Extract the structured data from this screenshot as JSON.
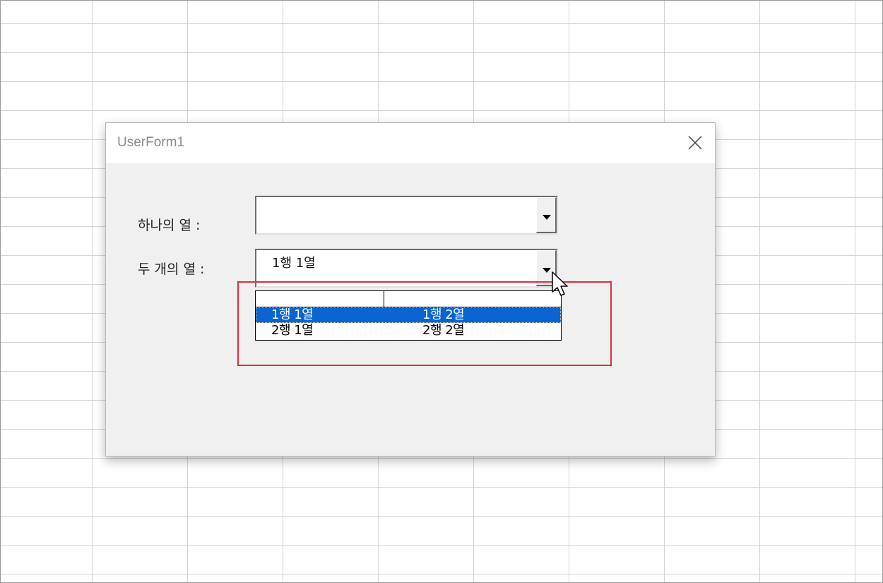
{
  "window": {
    "title": "UserForm1"
  },
  "form": {
    "label_one": "하나의 열 :",
    "label_two": "두 개의 열 :",
    "combo_one": {
      "value": ""
    },
    "combo_two": {
      "value": "1행 1열"
    }
  },
  "dropdown": {
    "rows": [
      {
        "col1": "1행 1열",
        "col2": "1행 2열",
        "selected": true
      },
      {
        "col1": "2행 1열",
        "col2": "2행 2열",
        "selected": false
      }
    ]
  },
  "colors": {
    "selection": "#0a64d2",
    "highlight": "#e52b3b",
    "dialog_bg": "#f0f0f0"
  },
  "icons": {
    "close": "close-icon",
    "dropdown": "chevron-down-icon",
    "cursor": "mouse-pointer-icon"
  }
}
